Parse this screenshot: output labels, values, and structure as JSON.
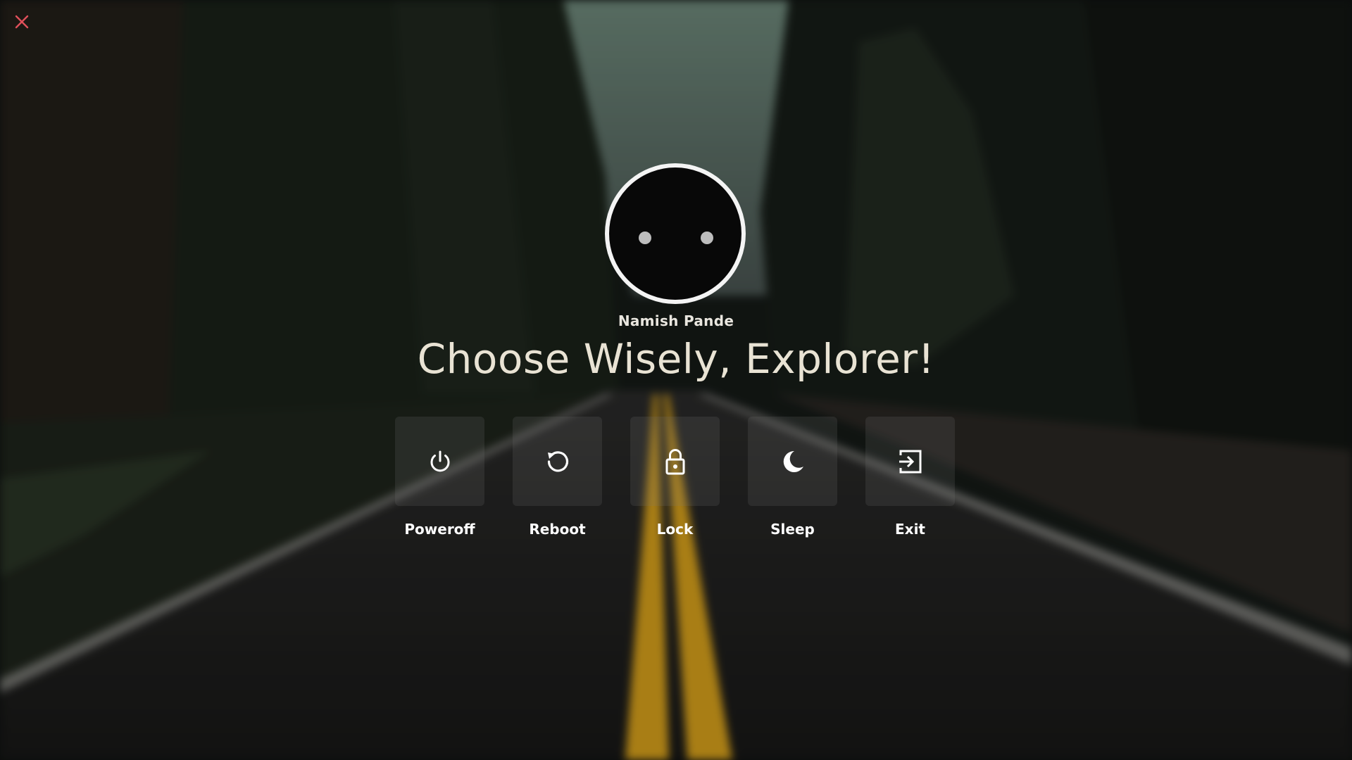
{
  "colors": {
    "close_icon": "#e0505a",
    "avatar_ring": "#f4f4f4",
    "road_line": "#d9a21c",
    "text_primary": "#ffffff",
    "headline": "#e9e3d4"
  },
  "close": {
    "icon": "close-icon"
  },
  "user": {
    "name": "Namish Pande"
  },
  "headline": "Choose Wisely, Explorer!",
  "actions": [
    {
      "label": "Poweroff",
      "icon": "power-icon"
    },
    {
      "label": "Reboot",
      "icon": "restart-icon"
    },
    {
      "label": "Lock",
      "icon": "lock-icon"
    },
    {
      "label": "Sleep",
      "icon": "moon-icon"
    },
    {
      "label": "Exit",
      "icon": "logout-icon"
    }
  ]
}
